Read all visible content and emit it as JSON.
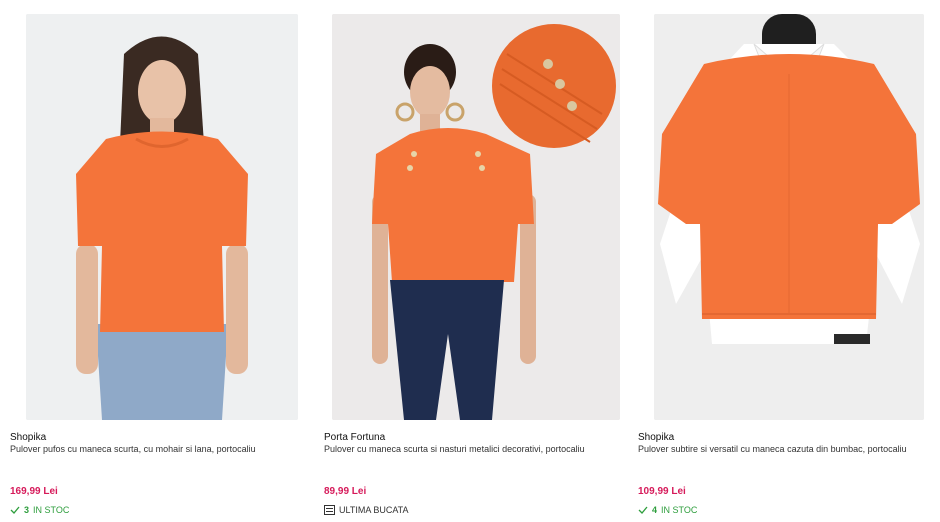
{
  "products": [
    {
      "brand": "Shopika",
      "title": "Pulover pufos cu maneca scurta, cu mohair si lana, portocaliu",
      "price": "169,99 Lei",
      "stock_qty": "3",
      "stock_text": "IN STOC",
      "stock_icon": "check-icon"
    },
    {
      "brand": "Porta Fortuna",
      "title": "Pulover cu maneca scurta si nasturi metalici decorativi, portocaliu",
      "price": "89,99 Lei",
      "stock_text": "ULTIMA BUCATA",
      "stock_icon": "box-icon"
    },
    {
      "brand": "Shopika",
      "title": "Pulover subtire si versatil cu maneca cazuta din bumbac, portocaliu",
      "price": "109,99 Lei",
      "stock_qty": "4",
      "stock_text": "IN STOC",
      "stock_icon": "check-icon"
    }
  ],
  "colors": {
    "price": "#d61a5a",
    "in_stock": "#2e9e3d",
    "sweater": "#f4743a"
  }
}
